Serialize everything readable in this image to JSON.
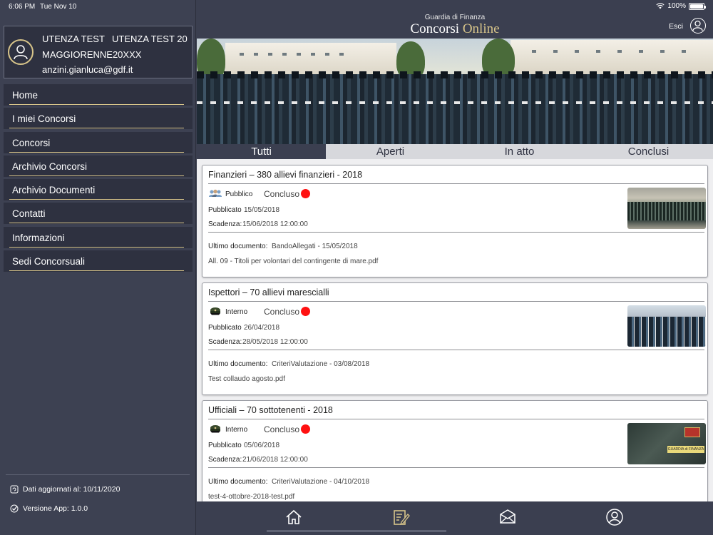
{
  "status_bar": {
    "time": "6:06 PM",
    "date": "Tue Nov 10",
    "battery": "100%"
  },
  "user": {
    "name_1": "UTENZA TEST",
    "name_2": "UTENZA TEST 20",
    "username": "MAGGIORENNE20XXX",
    "email": "anzini.gianluca@gdf.it"
  },
  "menu": [
    {
      "label": "Home"
    },
    {
      "label": "I miei Concorsi"
    },
    {
      "label": "Concorsi"
    },
    {
      "label": "Archivio Concorsi"
    },
    {
      "label": "Archivio Documenti"
    },
    {
      "label": "Contatti"
    },
    {
      "label": "Informazioni"
    },
    {
      "label": "Sedi Concorsuali"
    }
  ],
  "footer": {
    "updated": "Dati aggiornati al: 10/11/2020",
    "version": "Versione App: 1.0.0"
  },
  "header": {
    "subtitle": "Guardia di Finanza",
    "title_part1": "Concorsi ",
    "title_part2": "Online",
    "logout_label": "Esci"
  },
  "tabs": [
    {
      "label": "Tutti",
      "active": true
    },
    {
      "label": "Aperti",
      "active": false
    },
    {
      "label": "In atto",
      "active": false
    },
    {
      "label": "Conclusi",
      "active": false
    }
  ],
  "cards": [
    {
      "title": "Finanzieri – 380 allievi finanzieri - 2018",
      "type": "Pubblico",
      "type_icon": "people-group-icon",
      "status": "Concluso",
      "published_label": "Pubblicato",
      "published": "15/05/2018",
      "deadline_label": "Scadenza:",
      "deadline": "15/06/2018 12:00:00",
      "doc_label": "Ultimo documento:",
      "doc": "BandoAllegati - 15/05/2018",
      "file": "All. 09 - Titoli per volontari del contingente di mare.pdf"
    },
    {
      "title": "Ispettori – 70 allievi marescialli",
      "type": "Interno",
      "type_icon": "military-cap-icon",
      "status": "Concluso",
      "published_label": "Pubblicato",
      "published": "26/04/2018",
      "deadline_label": "Scadenza:",
      "deadline": "28/05/2018 12:00:00",
      "doc_label": "Ultimo documento:",
      "doc": "CriteriValutazione - 03/08/2018",
      "file": "Test collaudo agosto.pdf"
    },
    {
      "title": "Ufficiali – 70 sottotenenti - 2018",
      "type": "Interno",
      "type_icon": "military-cap-icon",
      "status": "Concluso",
      "published_label": "Pubblicato",
      "published": "05/06/2018",
      "deadline_label": "Scadenza:",
      "deadline": "21/06/2018 12:00:00",
      "doc_label": "Ultimo documento:",
      "doc": "CriteriValutazione - 04/10/2018",
      "file": "test-4-ottobre-2018-test.pdf"
    }
  ],
  "thumb_badge": "GUARDIA di FINANZA",
  "bottom_nav": [
    {
      "icon": "home-icon"
    },
    {
      "icon": "document-edit-icon",
      "active": true
    },
    {
      "icon": "mail-icon"
    },
    {
      "icon": "user-icon"
    }
  ],
  "colors": {
    "accent": "#d8c58a",
    "dark": "#3b3f50",
    "status_dot": "#ff1111"
  }
}
